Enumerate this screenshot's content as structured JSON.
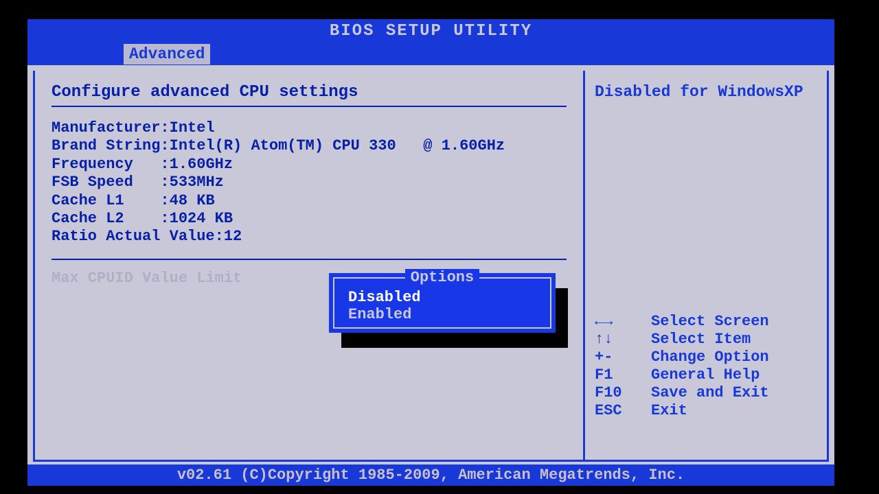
{
  "title": "BIOS SETUP UTILITY",
  "tab": "Advanced",
  "section_title": "Configure advanced CPU settings",
  "info": {
    "manufacturer_label": "Manufacturer:",
    "manufacturer_value": "Intel",
    "brand_label": "Brand String:",
    "brand_value": "Intel(R) Atom(TM) CPU 330   @ 1.60GHz",
    "freq_label": "Frequency   :",
    "freq_value": "1.60GHz",
    "fsb_label": "FSB Speed   :",
    "fsb_value": "533MHz",
    "l1_label": "Cache L1    :",
    "l1_value": "48 KB",
    "l2_label": "Cache L2    :",
    "l2_value": "1024 KB",
    "ratio_label": "Ratio Actual Value:",
    "ratio_value": "12"
  },
  "setting": {
    "label": "Max CPUID Value Limit"
  },
  "side_help": "Disabled for WindowsXP",
  "popup": {
    "title": "Options",
    "options": [
      "Disabled",
      "Enabled"
    ],
    "selected": "Disabled"
  },
  "keys": [
    {
      "key": "←→",
      "action": "Select Screen"
    },
    {
      "key": "↑↓",
      "action": "Select Item"
    },
    {
      "key": "+-",
      "action": "Change Option"
    },
    {
      "key": "F1",
      "action": "General Help"
    },
    {
      "key": "F10",
      "action": "Save and Exit"
    },
    {
      "key": "ESC",
      "action": "Exit"
    }
  ],
  "footer": "v02.61 (C)Copyright 1985-2009, American Megatrends, Inc."
}
